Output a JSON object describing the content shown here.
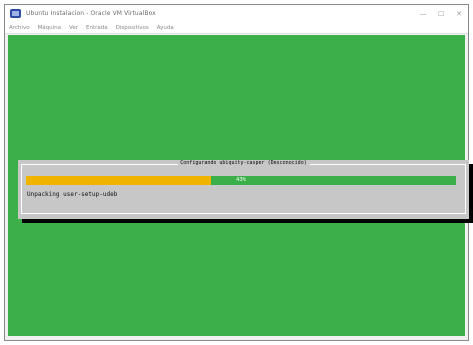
{
  "window": {
    "title": "Ubuntu Instalacion - Oracle VM VirtualBox",
    "minimize_glyph": "—",
    "maximize_glyph": "☐",
    "close_glyph": "✕"
  },
  "menubar": {
    "items": [
      "Archivo",
      "Máquina",
      "Ver",
      "Entrada",
      "Dispositivos",
      "Ayuda"
    ]
  },
  "installer": {
    "dialog_title": "Configurando ubiquity-casper (Desconocido)",
    "progress_percent": 43,
    "progress_label": "43%",
    "status_text": "Unpacking user-setup-udeb"
  },
  "colors": {
    "screen_background": "#3bb049",
    "progress_done": "#f0b400",
    "progress_remaining": "#3bb049",
    "dialog_background": "#c7c7c7"
  },
  "icons": {
    "app": "virtualbox-icon"
  }
}
